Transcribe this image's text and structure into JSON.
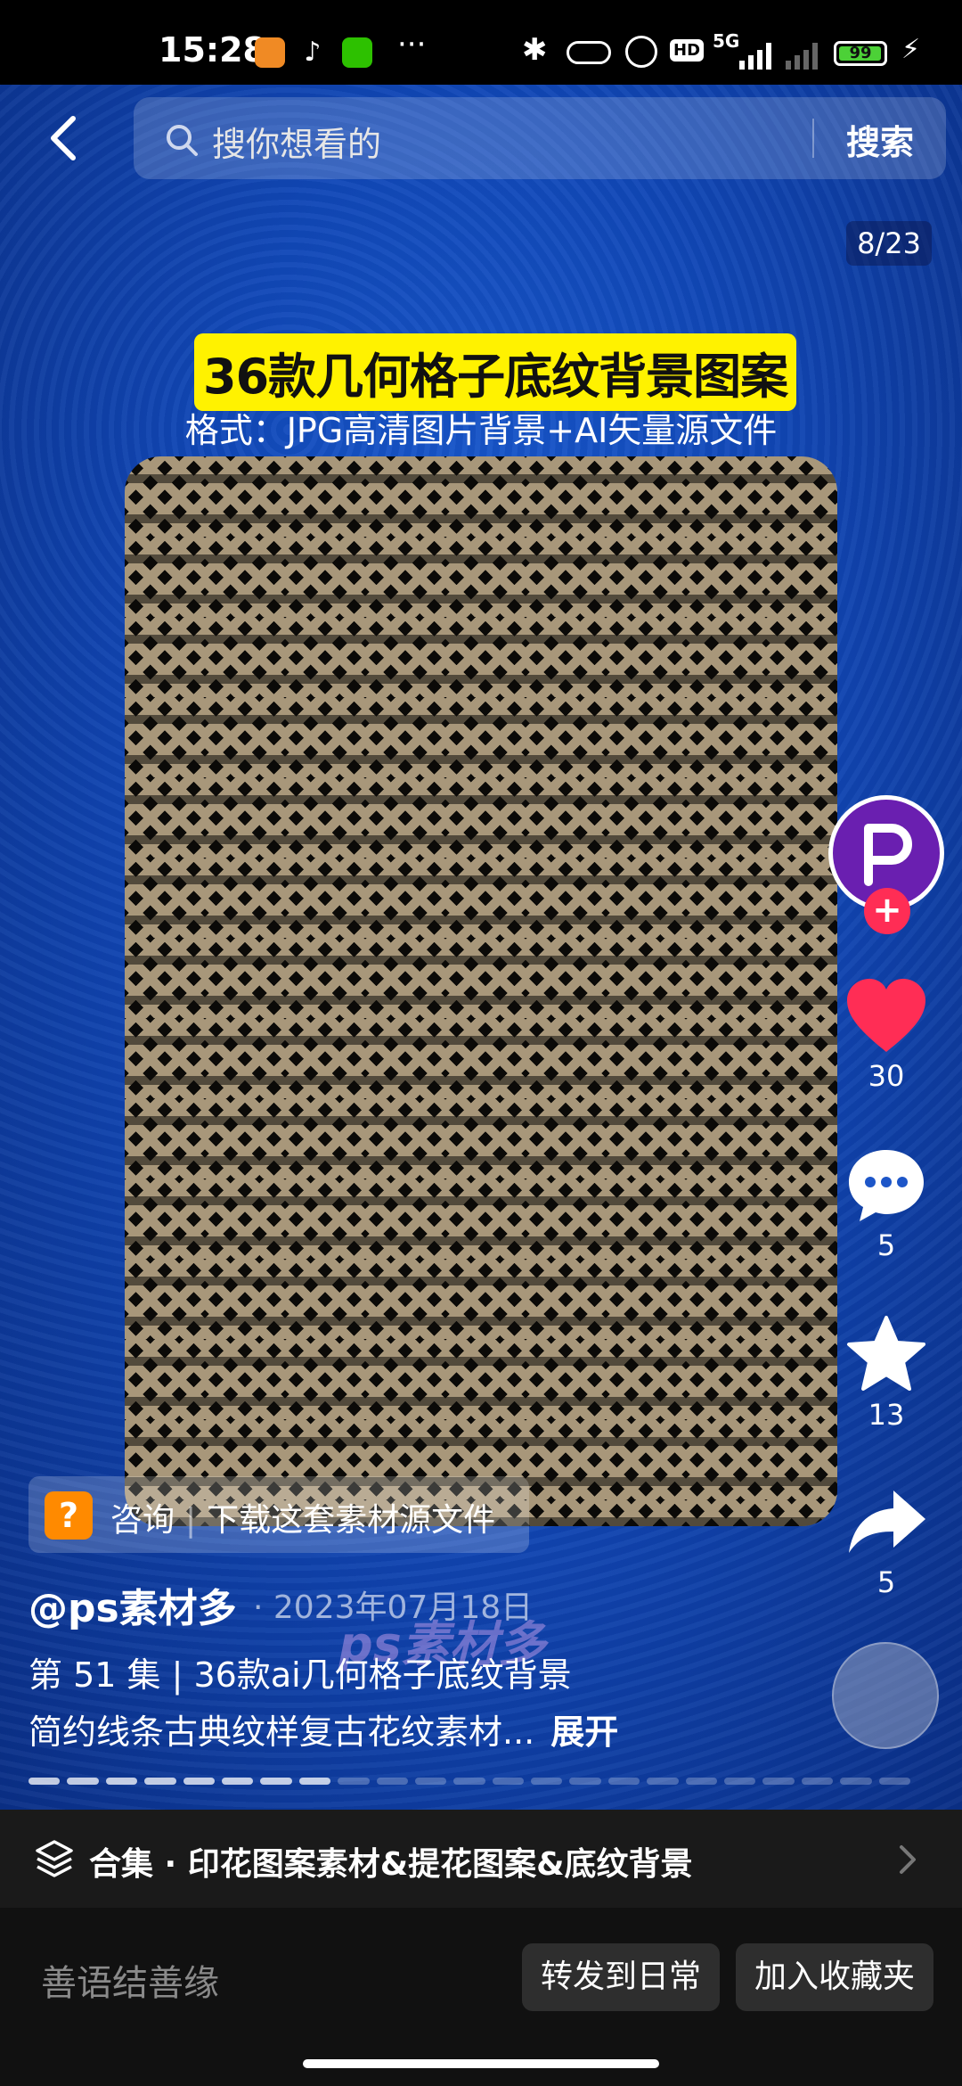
{
  "status_bar": {
    "time": "15:28",
    "network": "5G",
    "hd": "HD",
    "battery": "99"
  },
  "search": {
    "placeholder": "搜你想看的",
    "button": "搜索"
  },
  "image_counter": "8/23",
  "post_image": {
    "headline": "36款几何格子底纹背景图案",
    "subtitle": "格式：JPG高清图片背景+AI矢量源文件"
  },
  "actions": {
    "likes": "30",
    "comments": "5",
    "favorites": "13",
    "shares": "5"
  },
  "consult": {
    "label": "咨询",
    "text": "下载这套素材源文件"
  },
  "post": {
    "author": "@ps素材多",
    "date": "· 2023年07月18日",
    "watermark": "ps素材多",
    "episode": "第 51 集 | 36款ai几何格子底纹背景",
    "description": "简约线条古典纹样复古花纹素材...",
    "expand": "展开"
  },
  "progress": {
    "current": 8,
    "total": 23
  },
  "collection": {
    "text": "合集 · 印花图案素材&提花图案&底纹背景"
  },
  "bottom_bar": {
    "input_placeholder": "善语结善缘",
    "forward_button": "转发到日常",
    "favorite_button": "加入收藏夹"
  },
  "colors": {
    "accent_red": "#ff2d55",
    "headline_bg": "#fff200",
    "background_blue": "#1148b8"
  }
}
